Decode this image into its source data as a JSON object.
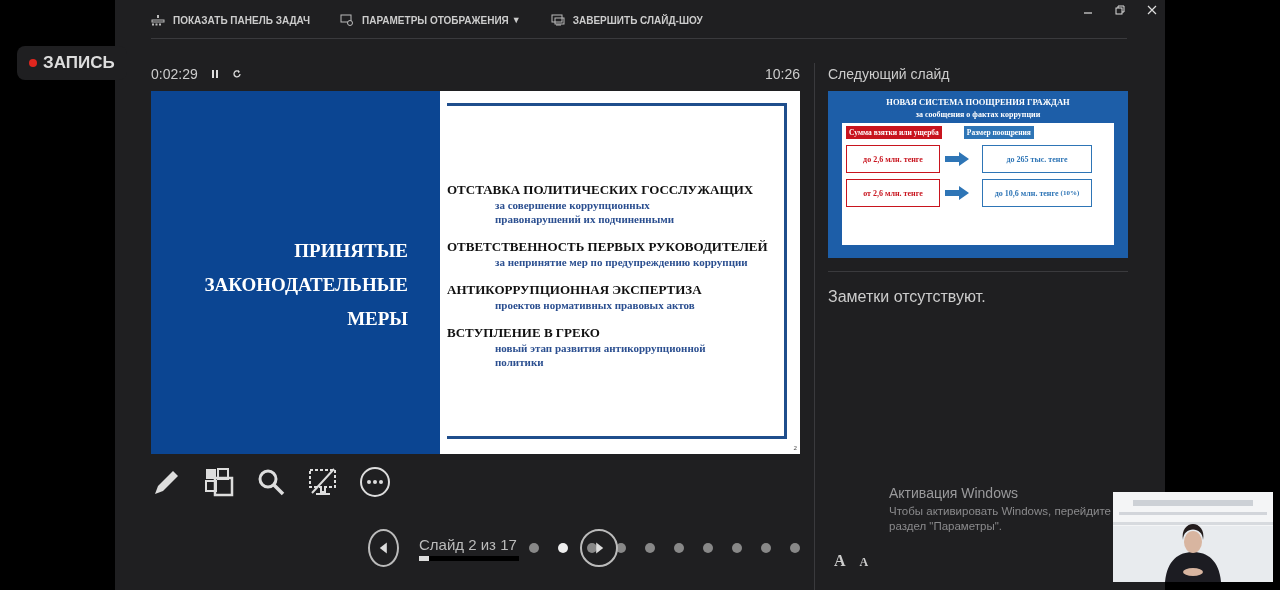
{
  "recording": {
    "label": "ЗАПИСЬ"
  },
  "toolbar": {
    "items": [
      {
        "label": "ПОКАЗАТЬ ПАНЕЛЬ ЗАДАЧ",
        "kind": "taskbar"
      },
      {
        "label": "ПАРАМЕТРЫ ОТОБРАЖЕНИЯ",
        "kind": "display",
        "caret": "▼"
      },
      {
        "label": "ЗАВЕРШИТЬ СЛАЙД-ШОУ",
        "kind": "end"
      }
    ]
  },
  "timer": {
    "elapsed": "0:02:29",
    "clock": "10:26"
  },
  "current_slide": {
    "title_lines": [
      "ПРИНЯТЫЕ",
      "ЗАКОНОДАТЕЛЬНЫЕ",
      "МЕРЫ"
    ],
    "points": [
      {
        "heading": "ОТСТАВКА ПОЛИТИЧЕСКИХ ГОССЛУЖАЩИХ",
        "lines": [
          "за совершение коррупционных",
          "правонарушений их подчиненными"
        ]
      },
      {
        "heading": "ОТВЕТСТВЕННОСТЬ ПЕРВЫХ РУКОВОДИТЕЛЕЙ",
        "lines": [
          "за непринятие мер по предупреждению коррупции"
        ]
      },
      {
        "heading": "АНТИКОРРУПЦИОННАЯ ЭКСПЕРТИЗА",
        "lines": [
          "проектов нормативных правовых актов"
        ]
      },
      {
        "heading": "ВСТУПЛЕНИЕ В ГРЕКО",
        "lines": [
          "новый этап развития антикоррупционной",
          "политики"
        ]
      }
    ],
    "number": "2"
  },
  "navigation": {
    "counter": "Слайд 2 из 17",
    "level": 0.1,
    "dots": [
      {
        "selected": false
      },
      {
        "selected": true
      },
      {
        "selected": false
      },
      {
        "selected": false
      },
      {
        "selected": false
      },
      {
        "selected": false
      },
      {
        "selected": false
      },
      {
        "selected": false
      },
      {
        "selected": false
      },
      {
        "selected": false
      }
    ]
  },
  "next_slide": {
    "heading": "Следующий слайд",
    "title": "НОВАЯ СИСТЕМА ПООЩРЕНИЯ ГРАЖДАН",
    "subtitle": "за сообщения о фактах коррупции",
    "left_label": "Сумма взятки или ущерба",
    "right_label": "Размер поощрения",
    "rows": [
      {
        "amount": "до 2,6 млн. тенге",
        "reward": "до 265 тыс. тенге"
      },
      {
        "amount": "от 2,6 млн. тенге",
        "reward": "до 10,6 млн. тенге",
        "note": "(10%)"
      }
    ]
  },
  "notes": "Заметки отсутствуют.",
  "activation": {
    "title": "Активация Windows",
    "lines": [
      "Чтобы активировать Windows, перейдите",
      "раздел \"Параметры\"."
    ]
  },
  "font_buttons": [
    {
      "label": "A",
      "kind": "increase"
    },
    {
      "label": "A",
      "kind": "decrease"
    }
  ]
}
